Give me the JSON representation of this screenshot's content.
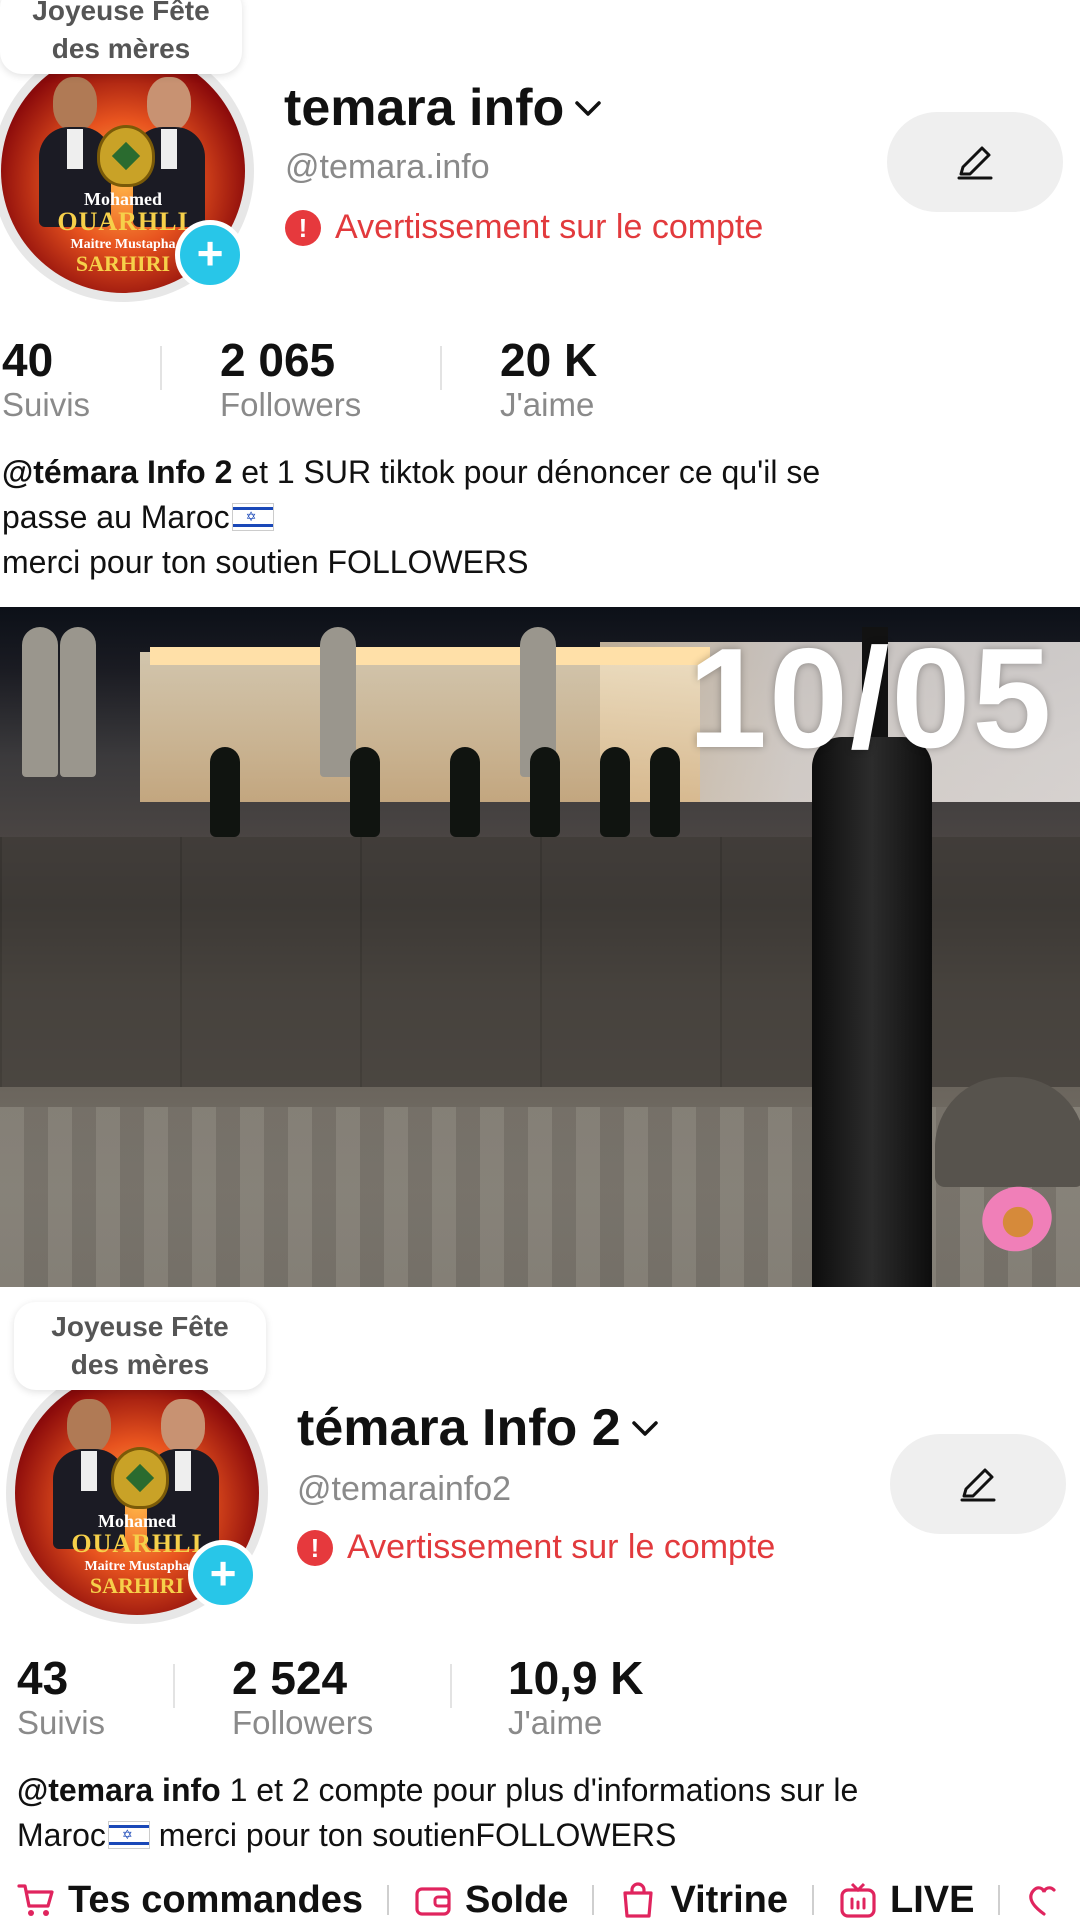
{
  "profile1": {
    "story_bubble": [
      "Joyeuse Fête",
      "des mères"
    ],
    "avatar_text": [
      "Mohamed",
      "OUARHLI",
      "Maitre Mustapha",
      "SARHIRI"
    ],
    "display_name": "temara info",
    "handle": "@temara.info",
    "warning": "Avertissement sur le compte",
    "stats": [
      {
        "value": "40",
        "label": "Suivis"
      },
      {
        "value": "2 065",
        "label": "Followers"
      },
      {
        "value": "20 K",
        "label": "J'aime"
      }
    ],
    "bio": {
      "mention": "@témara Info 2",
      "line1_rest": " et 1 SUR tiktok pour dénoncer ce qu'il se",
      "line2": "passe au Maroc",
      "line3": "merci pour ton soutien FOLLOWERS"
    }
  },
  "photo": {
    "date_overlay": "10/05"
  },
  "profile2": {
    "story_bubble": [
      "Joyeuse Fête",
      "des mères"
    ],
    "avatar_text": [
      "Mohamed",
      "OUARHLI",
      "Maitre Mustapha",
      "SARHIRI"
    ],
    "display_name": "témara Info 2",
    "handle": "@temarainfo2",
    "warning": "Avertissement sur le compte",
    "stats": [
      {
        "value": "43",
        "label": "Suivis"
      },
      {
        "value": "2 524",
        "label": "Followers"
      },
      {
        "value": "10,9 K",
        "label": "J'aime"
      }
    ],
    "bio": {
      "mention": "@temara info",
      "line1_rest": " 1 et 2 compte pour plus d'informations sur le",
      "line2": "Maroc",
      "line2_rest": " merci pour ton soutienFOLLOWERS"
    }
  },
  "bottom_nav": [
    {
      "label": "Tes commandes",
      "icon": "cart-icon"
    },
    {
      "label": "Solde",
      "icon": "wallet-icon"
    },
    {
      "label": "Vitrine",
      "icon": "shopping-bag-icon"
    },
    {
      "label": "LIVE",
      "icon": "live-tv-icon"
    }
  ],
  "colors": {
    "warning": "#e23a3d",
    "plus_badge": "#28c6e8",
    "nav_icon": "#e0245e"
  }
}
